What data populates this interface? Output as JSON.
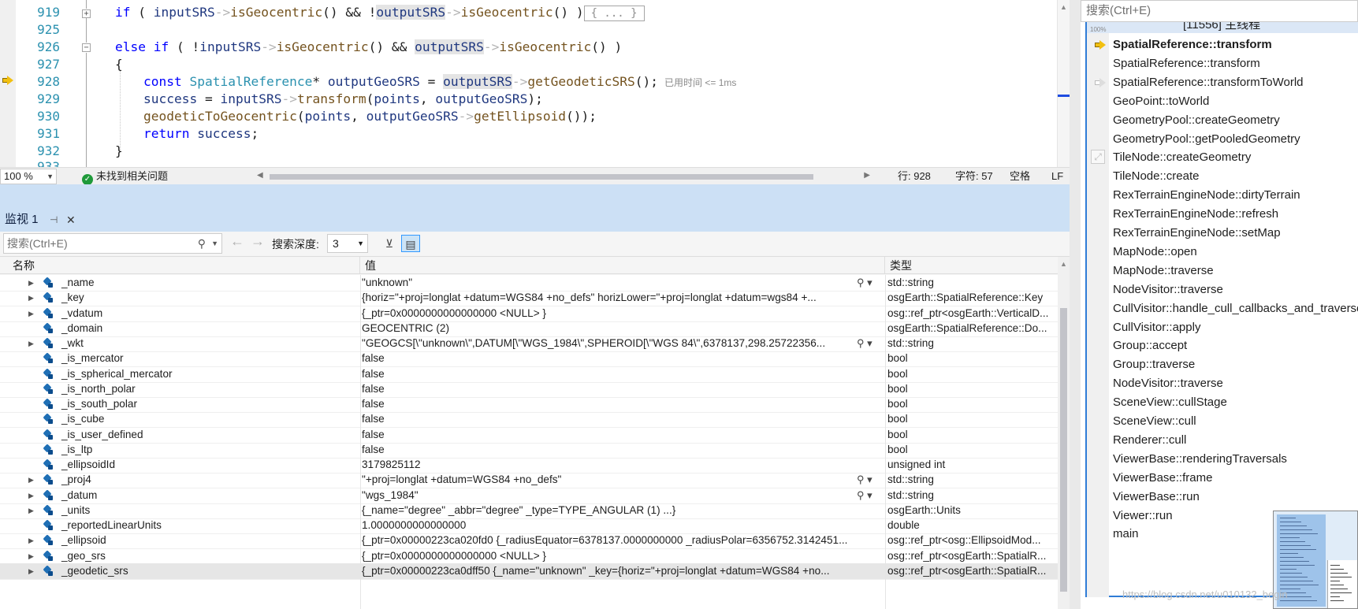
{
  "editor": {
    "line_numbers": [
      "919",
      "925",
      "926",
      "927",
      "928",
      "929",
      "930",
      "931",
      "932",
      "933"
    ],
    "line919": {
      "kw_if": "if",
      "p1": " ( ",
      "id_input": "inputSRS",
      "arrow": "->",
      "fn": "isGeocentric",
      "p2": "() && !",
      "id_output": "outputSRS",
      "p3": "() )",
      "collapsed": "{ ... }"
    },
    "line926": {
      "kw_else": "else",
      "kw_if": "if",
      "p1": " ( !",
      "id_input": "inputSRS",
      "arrow": "->",
      "fn": "isGeocentric",
      "p2": "() && ",
      "id_output": "outputSRS",
      "p3": "() )"
    },
    "line927": "{",
    "line928": {
      "kw_const": "const",
      "type": "SpatialReference",
      "p1": "* ",
      "id_var": "outputGeoSRS",
      "p2": " = ",
      "id_output": "outputSRS",
      "arrow": "->",
      "fn": "getGeodeticSRS",
      "p3": "();",
      "perf": "已用时间 <= 1ms"
    },
    "line929": {
      "id_success": "success",
      "p1": " = ",
      "id_input": "inputSRS",
      "arrow": "->",
      "fn": "transform",
      "p2": "(",
      "id_points": "points",
      "p3": ", ",
      "id_var": "outputGeoSRS",
      "p4": ");"
    },
    "line930": {
      "fn": "geodeticToGeocentric",
      "p1": "(",
      "id_points": "points",
      "p2": ", ",
      "id_var": "outputGeoSRS",
      "arrow": "->",
      "fn2": "getEllipsoid",
      "p3": "());"
    },
    "line931": {
      "kw_return": "return",
      "id_success": "success",
      "p1": ";"
    },
    "line932": "}",
    "status": {
      "zoom": "100 %",
      "issues": "未找到相关问题",
      "line": "行: 928",
      "char": "字符: 57",
      "spaces": "空格",
      "eol": "LF"
    }
  },
  "watch": {
    "tab_title": "监视 1",
    "search_placeholder": "搜索(Ctrl+E)",
    "depth_label": "搜索深度:",
    "depth_value": "3",
    "columns": {
      "name": "名称",
      "value": "值",
      "type": "类型"
    },
    "rows": [
      {
        "name": "_name",
        "value": "\"unknown\"",
        "type": "std::string"
      },
      {
        "name": "_key",
        "value": "{horiz=\"+proj=longlat +datum=WGS84 +no_defs\" horizLower=\"+proj=longlat +datum=wgs84 +...",
        "type": "osgEarth::SpatialReference::Key"
      },
      {
        "name": "_vdatum",
        "value": "{_ptr=0x0000000000000000 <NULL> }",
        "type": "osg::ref_ptr<osgEarth::VerticalD..."
      },
      {
        "name": "_domain",
        "value": "GEOCENTRIC (2)",
        "type": "osgEarth::SpatialReference::Do..."
      },
      {
        "name": "_wkt",
        "value": "\"GEOGCS[\\\"unknown\\\",DATUM[\\\"WGS_1984\\\",SPHEROID[\\\"WGS 84\\\",6378137,298.25722356...",
        "type": "std::string"
      },
      {
        "name": "_is_mercator",
        "value": "false",
        "type": "bool"
      },
      {
        "name": "_is_spherical_mercator",
        "value": "false",
        "type": "bool"
      },
      {
        "name": "_is_north_polar",
        "value": "false",
        "type": "bool"
      },
      {
        "name": "_is_south_polar",
        "value": "false",
        "type": "bool"
      },
      {
        "name": "_is_cube",
        "value": "false",
        "type": "bool"
      },
      {
        "name": "_is_user_defined",
        "value": "false",
        "type": "bool"
      },
      {
        "name": "_is_ltp",
        "value": "false",
        "type": "bool"
      },
      {
        "name": "_ellipsoidId",
        "value": "3179825112",
        "type": "unsigned int"
      },
      {
        "name": "_proj4",
        "value": "\"+proj=longlat +datum=WGS84 +no_defs\"",
        "type": "std::string"
      },
      {
        "name": "_datum",
        "value": "\"wgs_1984\"",
        "type": "std::string"
      },
      {
        "name": "_units",
        "value": "{_name=\"degree\" _abbr=\"degree\" _type=TYPE_ANGULAR (1) ...}",
        "type": "osgEarth::Units"
      },
      {
        "name": "_reportedLinearUnits",
        "value": "1.0000000000000000",
        "type": "double"
      },
      {
        "name": "_ellipsoid",
        "value": "{_ptr=0x00000223ca020fd0 {_radiusEquator=6378137.0000000000 _radiusPolar=6356752.3142451...",
        "type": "osg::ref_ptr<osg::EllipsoidMod..."
      },
      {
        "name": "_geo_srs",
        "value": "{_ptr=0x0000000000000000 <NULL> }",
        "type": "osg::ref_ptr<osgEarth::SpatialR..."
      },
      {
        "name": "_geodetic_srs",
        "value": "{_ptr=0x00000223ca0dff50 {_name=\"unknown\" _key={horiz=\"+proj=longlat +datum=WGS84 +no...",
        "type": "osg::ref_ptr<osgEarth::SpatialR..."
      }
    ]
  },
  "call_stack": {
    "search_placeholder": "搜索(Ctrl+E)",
    "zoom_pct": "100%",
    "thread": "[11556] 主线程",
    "frames": [
      "SpatialReference::transform",
      "SpatialReference::transform",
      "SpatialReference::transformToWorld",
      "GeoPoint::toWorld",
      "GeometryPool::createGeometry",
      "GeometryPool::getPooledGeometry",
      "TileNode::createGeometry",
      "TileNode::create",
      "RexTerrainEngineNode::dirtyTerrain",
      "RexTerrainEngineNode::refresh",
      "RexTerrainEngineNode::setMap",
      "MapNode::open",
      "MapNode::traverse",
      "NodeVisitor::traverse",
      "CullVisitor::handle_cull_callbacks_and_traverse",
      "CullVisitor::apply",
      "Group::accept",
      "Group::traverse",
      "NodeVisitor::traverse",
      "SceneView::cullStage",
      "SceneView::cull",
      "Renderer::cull",
      "ViewerBase::renderingTraversals",
      "ViewerBase::frame",
      "ViewerBase::run",
      "Viewer::run",
      "main"
    ],
    "watermark": "https://blog.csdn.net/u010132_begin"
  },
  "colors": {
    "keyword": "#0000ff",
    "type": "#2b91af",
    "function": "#74531f",
    "identifier": "#1f377f",
    "accent": "#2f7cd6",
    "tab_bg": "#cce0f5"
  },
  "icons": {
    "current_frame": "yellow-arrow-icon",
    "watch_item": "object-cube-icon",
    "ok": "check-circle-icon"
  }
}
